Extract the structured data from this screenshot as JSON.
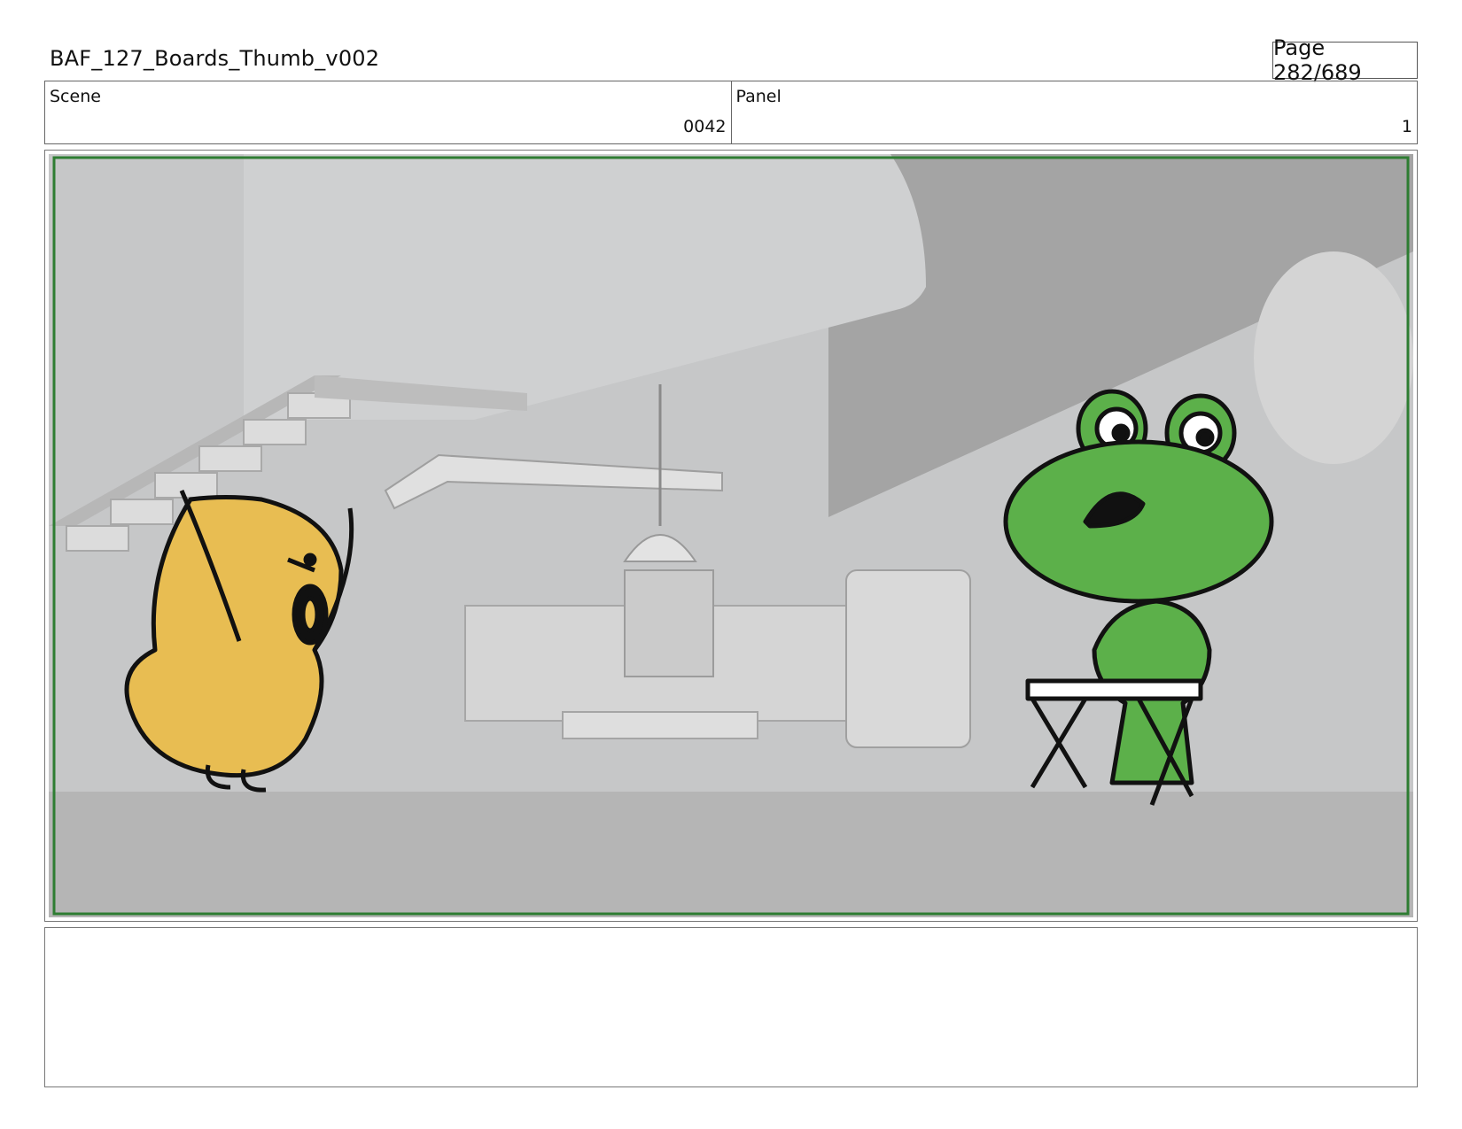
{
  "header": {
    "title": "BAF_127_Boards_Thumb_v002",
    "page": "Page 282/689"
  },
  "info": {
    "scene_label": "Scene",
    "scene_value": "0042",
    "panel_label": "Panel",
    "panel_value": "1"
  },
  "panel": {
    "safe_frame_color": "#2e7d32",
    "background_tone": "#c9c9c9",
    "characters": [
      "yellow-chick",
      "green-frog"
    ],
    "colors": {
      "chick": "#e8bd52",
      "frog": "#5cb04a",
      "outline": "#111111"
    }
  },
  "notes": {
    "text": ""
  }
}
